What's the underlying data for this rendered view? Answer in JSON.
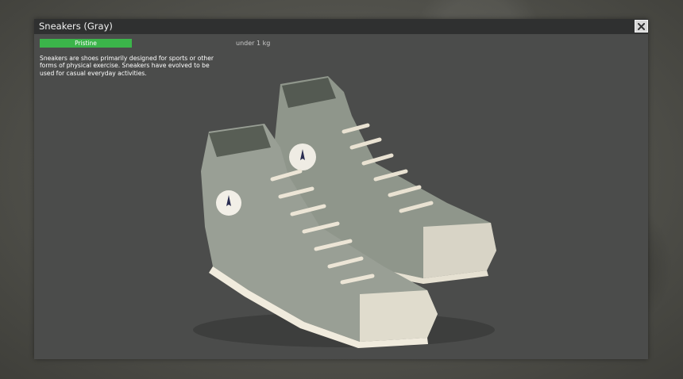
{
  "item": {
    "title": "Sneakers (Gray)",
    "condition": "Pristine",
    "weight": "under 1 kg",
    "description": "Sneakers are shoes primarily designed for sports or other forms of physical exercise. Sneakers have evolved to be used for casual everyday activities."
  },
  "icons": {
    "close": "close-icon"
  },
  "colors": {
    "condition": "#3bb54a",
    "panel": "#4b4c4b",
    "titlebar": "#2f3030"
  }
}
